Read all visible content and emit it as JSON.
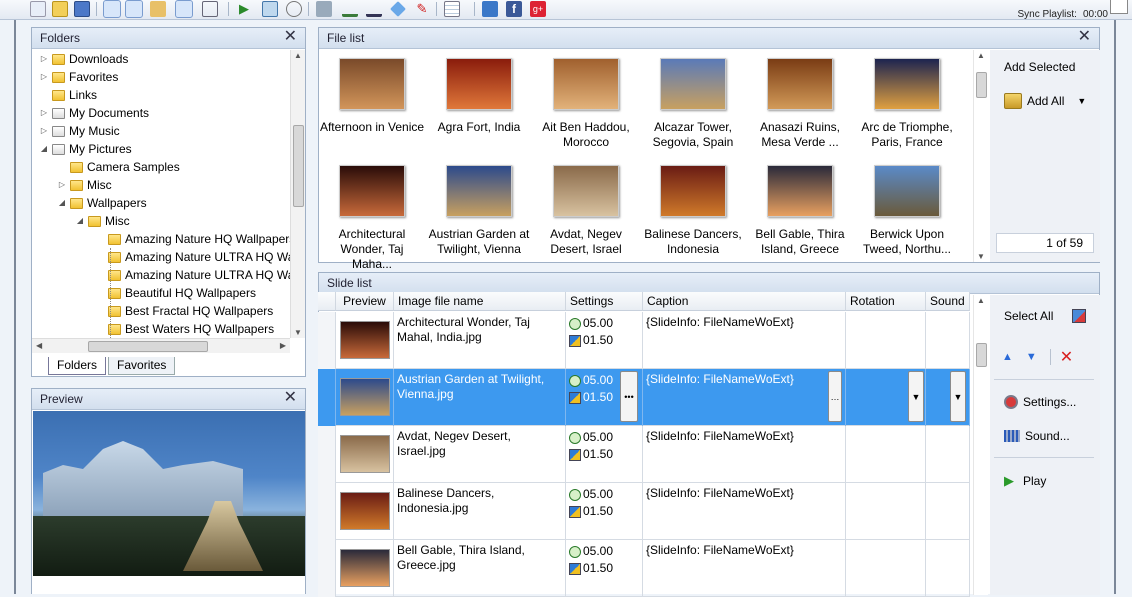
{
  "toolbar": {
    "sync_label": "Sync Playlist:",
    "sync_value": "00:00"
  },
  "folders_panel": {
    "title": "Folders",
    "items": [
      {
        "label": "Downloads"
      },
      {
        "label": "Favorites"
      },
      {
        "label": "Links"
      },
      {
        "label": "My Documents"
      },
      {
        "label": "My Music"
      },
      {
        "label": "My Pictures"
      },
      {
        "label": "Camera Samples"
      },
      {
        "label": "Misc"
      },
      {
        "label": "Wallpapers"
      },
      {
        "label": "Misc"
      },
      {
        "label": "Amazing Nature HQ Wallpapers"
      },
      {
        "label": "Amazing Nature ULTRA HQ Wallpapers"
      },
      {
        "label": "Amazing Nature ULTRA HQ Wallpapers"
      },
      {
        "label": "Beautiful HQ Wallpapers"
      },
      {
        "label": "Best Fractal HQ Wallpapers"
      },
      {
        "label": "Best Waters HQ Wallpapers"
      }
    ],
    "tabs": [
      "Folders",
      "Favorites"
    ]
  },
  "preview_panel": {
    "title": "Preview"
  },
  "file_list": {
    "title": "File list",
    "items": [
      {
        "caption": "Afternoon in Venice",
        "colors": [
          "#7a4a2a",
          "#d2955a"
        ]
      },
      {
        "caption": "Agra Fort, India",
        "colors": [
          "#8a1c0c",
          "#e0783a"
        ]
      },
      {
        "caption": "Ait Ben Haddou, Morocco",
        "colors": [
          "#a0602e",
          "#e2b27a"
        ]
      },
      {
        "caption": "Alcazar Tower, Segovia, Spain",
        "colors": [
          "#5a7ab8",
          "#c8a060"
        ]
      },
      {
        "caption": "Anasazi Ruins, Mesa Verde ...",
        "colors": [
          "#7a3c14",
          "#d29a58"
        ]
      },
      {
        "caption": "Arc de Triomphe, Paris, France",
        "colors": [
          "#1c2450",
          "#e0a040"
        ]
      },
      {
        "caption": "Architectural Wonder, Taj Maha...",
        "colors": [
          "#2a0c08",
          "#c86a3a"
        ]
      },
      {
        "caption": "Austrian Garden at Twilight, Vienna",
        "colors": [
          "#2c4a8c",
          "#c8a060"
        ]
      },
      {
        "caption": "Avdat, Negev Desert, Israel",
        "colors": [
          "#8a6a4a",
          "#d8c2a0"
        ]
      },
      {
        "caption": "Balinese Dancers, Indonesia",
        "colors": [
          "#6a1c14",
          "#d07a2a"
        ]
      },
      {
        "caption": "Bell Gable, Thira Island, Greece",
        "colors": [
          "#2a2a3a",
          "#e8a060"
        ]
      },
      {
        "caption": "Berwick Upon Tweed, Northu...",
        "colors": [
          "#5a8ac8",
          "#6a5a3a"
        ]
      }
    ],
    "add_selected": "Add Selected",
    "add_all": "Add All",
    "counter": "1 of 59"
  },
  "slide_list": {
    "title": "Slide list",
    "columns": [
      "Preview",
      "Image file name",
      "Settings",
      "Caption",
      "Rotation",
      "Sound"
    ],
    "rows": [
      {
        "file": "Architectural Wonder, Taj Mahal, India.jpg",
        "duration": "05.00",
        "transition": "01.50",
        "caption": "{SlideInfo: FileNameWoExt}",
        "selected": false,
        "colors": [
          "#2a0c08",
          "#c86a3a"
        ]
      },
      {
        "file": "Austrian Garden at Twilight, Vienna.jpg",
        "duration": "05.00",
        "transition": "01.50",
        "caption": "{SlideInfo: FileNameWoExt}",
        "selected": true,
        "colors": [
          "#2c4a8c",
          "#c8a060"
        ]
      },
      {
        "file": "Avdat, Negev Desert, Israel.jpg",
        "duration": "05.00",
        "transition": "01.50",
        "caption": "{SlideInfo: FileNameWoExt}",
        "selected": false,
        "colors": [
          "#8a6a4a",
          "#d8c2a0"
        ]
      },
      {
        "file": "Balinese Dancers, Indonesia.jpg",
        "duration": "05.00",
        "transition": "01.50",
        "caption": "{SlideInfo: FileNameWoExt}",
        "selected": false,
        "colors": [
          "#6a1c14",
          "#d07a2a"
        ]
      },
      {
        "file": "Bell Gable, Thira Island, Greece.jpg",
        "duration": "05.00",
        "transition": "01.50",
        "caption": "{SlideInfo: FileNameWoExt}",
        "selected": false,
        "colors": [
          "#2a2a3a",
          "#e8a060"
        ]
      }
    ],
    "select_all": "Select All",
    "settings_btn": "Settings...",
    "sound_btn": "Sound...",
    "play_btn": "Play"
  }
}
